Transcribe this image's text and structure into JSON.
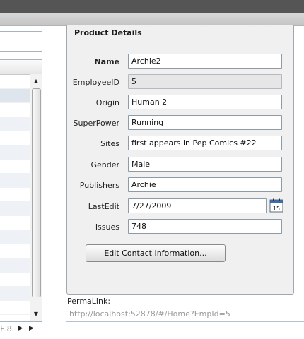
{
  "panel": {
    "title": "Product Details",
    "fields": [
      {
        "label": "Name",
        "value": "Archie2"
      },
      {
        "label": "EmployeeID",
        "value": "5"
      },
      {
        "label": "Origin",
        "value": "Human 2"
      },
      {
        "label": "SuperPower",
        "value": "Running"
      },
      {
        "label": "Sites",
        "value": "first appears in Pep Comics #22"
      },
      {
        "label": "Gender",
        "value": "Male"
      },
      {
        "label": "Publishers",
        "value": "Archie"
      },
      {
        "label": "LastEdit",
        "value": "7/27/2009"
      },
      {
        "label": "Issues",
        "value": "748"
      }
    ],
    "calendar_day": "15",
    "edit_button_label": "Edit Contact Information..."
  },
  "permalink": {
    "label": "PermaLink:",
    "url": "http://localhost:52878/#/Home?EmpId=5"
  },
  "pager": {
    "text": "F 8",
    "next_icon": "play-icon",
    "last_icon": "skip-end-icon"
  },
  "grid": {
    "scroll_up_icon": "triangle-up-icon",
    "scroll_down_icon": "triangle-down-icon"
  },
  "colors": {
    "topbar": "#555555",
    "panel_bg": "#f0f0f0",
    "readonly_bg": "#e6e6e6",
    "border": "#9fa9b3"
  }
}
